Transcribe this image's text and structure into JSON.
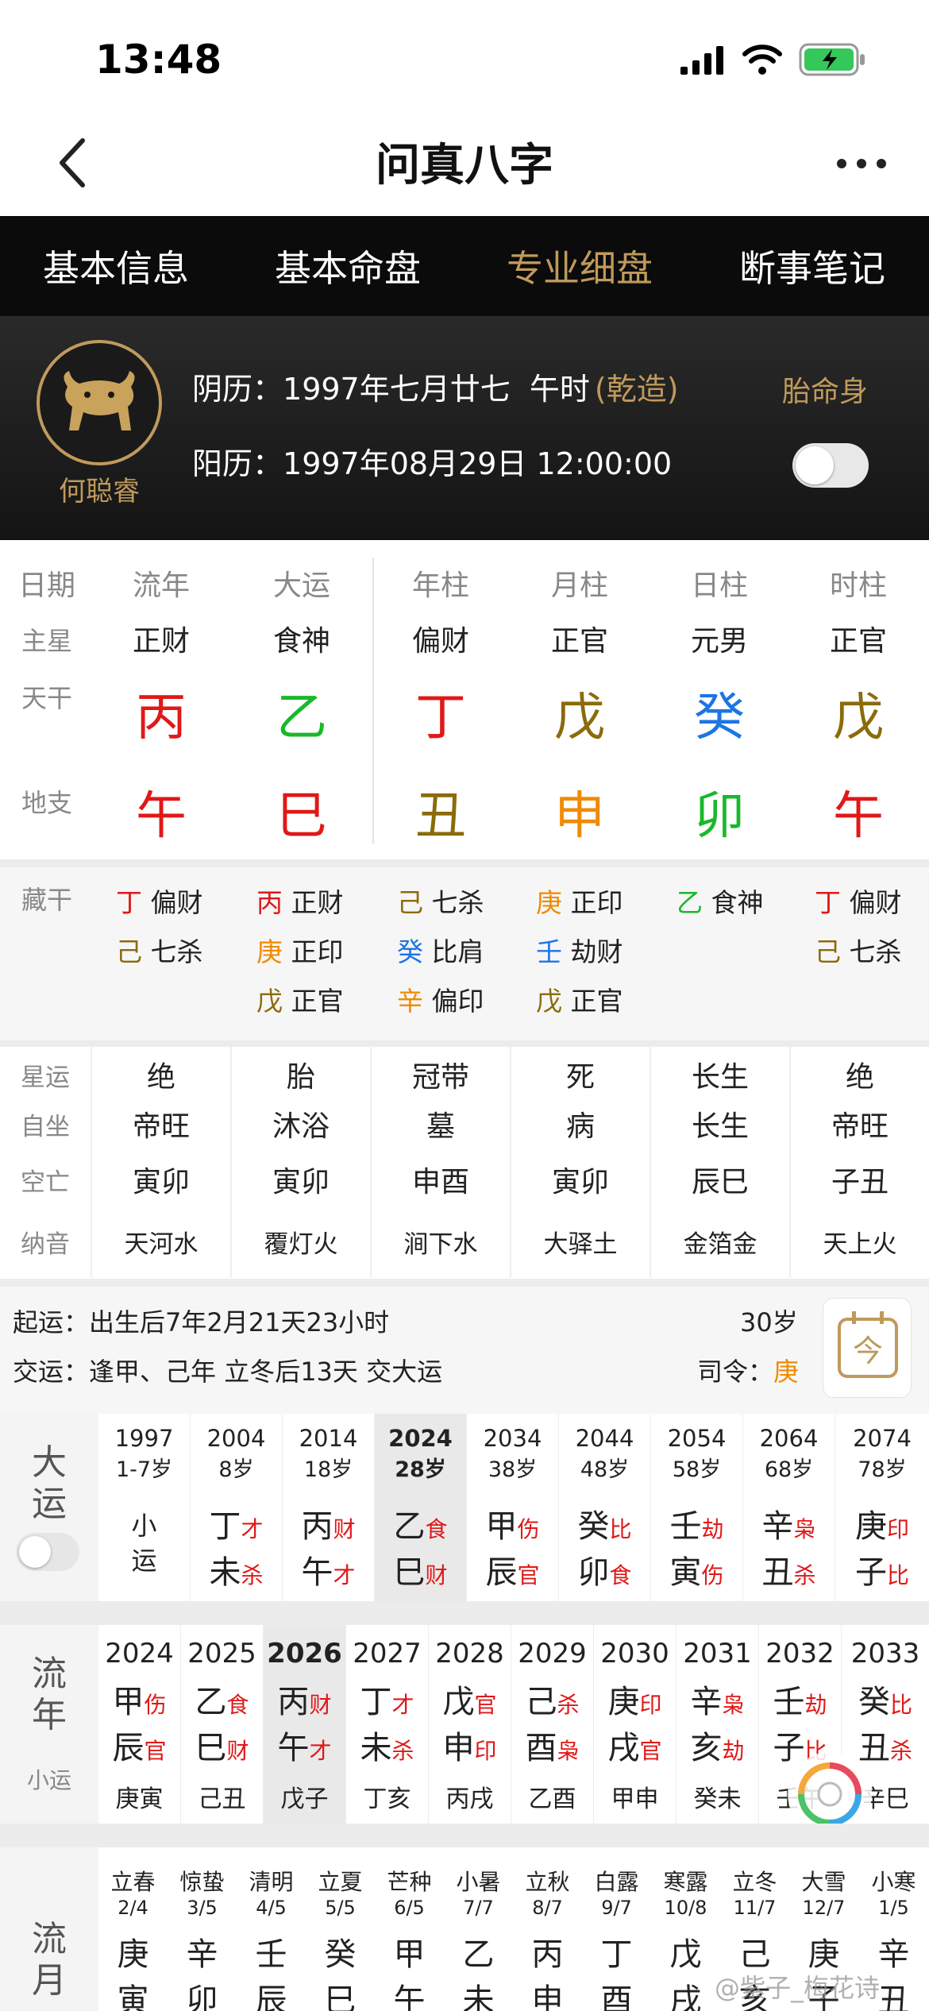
{
  "status": {
    "time": "13:48"
  },
  "nav": {
    "title": "问真八字"
  },
  "tabs": [
    "基本信息",
    "基本命盘",
    "专业细盘",
    "断事笔记"
  ],
  "profile": {
    "name": "何聪睿",
    "lunar_label": "阴历：",
    "lunar_value": "1997年七月廿七  午时",
    "gender_tag": "(乾造)",
    "solar_label": "阳历：",
    "solar_value": "1997年08月29日 12:00:00",
    "taiming_label": "胎命身"
  },
  "colors": {
    "red": "#e01818",
    "green": "#19b82a",
    "olive": "#8b6b0a",
    "blue": "#1d74e6",
    "orange": "#f08a00",
    "gold": "#c09a5b"
  },
  "pillars": {
    "header": [
      "日期",
      "流年",
      "大运",
      "年柱",
      "月柱",
      "日柱",
      "时柱"
    ],
    "row_labels": [
      "主星",
      "天干",
      "地支"
    ],
    "zhuxing": [
      "正财",
      "食神",
      "偏财",
      "正官",
      "元男",
      "正官"
    ],
    "tiangan": [
      {
        "c": "丙",
        "color": "red"
      },
      {
        "c": "乙",
        "color": "green"
      },
      {
        "c": "丁",
        "color": "red"
      },
      {
        "c": "戊",
        "color": "olive"
      },
      {
        "c": "癸",
        "color": "blue"
      },
      {
        "c": "戊",
        "color": "olive"
      }
    ],
    "dizhi": [
      {
        "c": "午",
        "color": "red"
      },
      {
        "c": "巳",
        "color": "red"
      },
      {
        "c": "丑",
        "color": "olive"
      },
      {
        "c": "申",
        "color": "orange"
      },
      {
        "c": "卯",
        "color": "green"
      },
      {
        "c": "午",
        "color": "red"
      }
    ]
  },
  "canggan": {
    "label": "藏干",
    "columns": [
      [
        {
          "g": "丁",
          "color": "red",
          "s": "偏财"
        },
        {
          "g": "己",
          "color": "olive",
          "s": "七杀"
        }
      ],
      [
        {
          "g": "丙",
          "color": "red",
          "s": "正财"
        },
        {
          "g": "庚",
          "color": "orange",
          "s": "正印"
        },
        {
          "g": "戊",
          "color": "olive",
          "s": "正官"
        }
      ],
      [
        {
          "g": "己",
          "color": "olive",
          "s": "七杀"
        },
        {
          "g": "癸",
          "color": "blue",
          "s": "比肩"
        },
        {
          "g": "辛",
          "color": "orange",
          "s": "偏印"
        }
      ],
      [
        {
          "g": "庚",
          "color": "orange",
          "s": "正印"
        },
        {
          "g": "壬",
          "color": "blue",
          "s": "劫财"
        },
        {
          "g": "戊",
          "color": "olive",
          "s": "正官"
        }
      ],
      [
        {
          "g": "乙",
          "color": "green",
          "s": "食神"
        }
      ],
      [
        {
          "g": "丁",
          "color": "red",
          "s": "偏财"
        },
        {
          "g": "己",
          "color": "olive",
          "s": "七杀"
        }
      ]
    ]
  },
  "xingyun": {
    "labels": [
      "星运",
      "自坐",
      "空亡",
      "纳音"
    ],
    "columns": [
      [
        "绝",
        "帝旺",
        "寅卯",
        "天河水"
      ],
      [
        "胎",
        "沐浴",
        "寅卯",
        "覆灯火"
      ],
      [
        "冠带",
        "墓",
        "申酉",
        "涧下水"
      ],
      [
        "死",
        "病",
        "寅卯",
        "大驿土"
      ],
      [
        "长生",
        "长生",
        "辰巳",
        "金箔金"
      ],
      [
        "绝",
        "帝旺",
        "子丑",
        "天上火"
      ]
    ]
  },
  "qiyun": {
    "qiyun_label": "起运：",
    "qiyun_text": "出生后7年2月21天23小时",
    "age": "30岁",
    "jiaoyun_label": "交运：",
    "jiaoyun_text": "逢甲、己年 立冬后13天 交大运",
    "siling_label": "司令：",
    "siling_value": "庚",
    "today_icon": "今"
  },
  "dayun": {
    "label": "大运",
    "items": [
      {
        "year": "1997",
        "age": "1-7岁",
        "small": "小\n运"
      },
      {
        "year": "2004",
        "age": "8岁",
        "g": "丁",
        "gs": "才",
        "z": "未",
        "zs": "杀"
      },
      {
        "year": "2014",
        "age": "18岁",
        "g": "丙",
        "gs": "财",
        "z": "午",
        "zs": "才"
      },
      {
        "year": "2024",
        "age": "28岁",
        "g": "乙",
        "gs": "食",
        "z": "巳",
        "zs": "财",
        "selected": true
      },
      {
        "year": "2034",
        "age": "38岁",
        "g": "甲",
        "gs": "伤",
        "z": "辰",
        "zs": "官"
      },
      {
        "year": "2044",
        "age": "48岁",
        "g": "癸",
        "gs": "比",
        "z": "卯",
        "zs": "食"
      },
      {
        "year": "2054",
        "age": "58岁",
        "g": "壬",
        "gs": "劫",
        "z": "寅",
        "zs": "伤"
      },
      {
        "year": "2064",
        "age": "68岁",
        "g": "辛",
        "gs": "枭",
        "z": "丑",
        "zs": "杀"
      },
      {
        "year": "2074",
        "age": "78岁",
        "g": "庚",
        "gs": "印",
        "z": "子",
        "zs": "比"
      }
    ]
  },
  "liunian": {
    "label": "流年",
    "sub_label": "小运",
    "items": [
      {
        "year": "2024",
        "g": "甲",
        "gs": "伤",
        "z": "辰",
        "zs": "官",
        "xy": "庚寅"
      },
      {
        "year": "2025",
        "g": "乙",
        "gs": "食",
        "z": "巳",
        "zs": "财",
        "xy": "己丑"
      },
      {
        "year": "2026",
        "g": "丙",
        "gs": "财",
        "z": "午",
        "zs": "才",
        "xy": "戊子",
        "selected": true
      },
      {
        "year": "2027",
        "g": "丁",
        "gs": "才",
        "z": "未",
        "zs": "杀",
        "xy": "丁亥"
      },
      {
        "year": "2028",
        "g": "戊",
        "gs": "官",
        "z": "申",
        "zs": "印",
        "xy": "丙戌"
      },
      {
        "year": "2029",
        "g": "己",
        "gs": "杀",
        "z": "酉",
        "zs": "枭",
        "xy": "乙酉"
      },
      {
        "year": "2030",
        "g": "庚",
        "gs": "印",
        "z": "戌",
        "zs": "官",
        "xy": "甲申"
      },
      {
        "year": "2031",
        "g": "辛",
        "gs": "枭",
        "z": "亥",
        "zs": "劫",
        "xy": "癸未"
      },
      {
        "year": "2032",
        "g": "壬",
        "gs": "劫",
        "z": "子",
        "zs": "比",
        "xy": "壬午"
      },
      {
        "year": "2033",
        "g": "癸",
        "gs": "比",
        "z": "丑",
        "zs": "杀",
        "xy": "辛巳"
      }
    ]
  },
  "liuyue": {
    "label": "流月",
    "items": [
      {
        "jq": "立春",
        "d": "2/4",
        "g": "庚",
        "z": "寅"
      },
      {
        "jq": "惊蛰",
        "d": "3/5",
        "g": "辛",
        "z": "卯"
      },
      {
        "jq": "清明",
        "d": "4/5",
        "g": "壬",
        "z": "辰"
      },
      {
        "jq": "立夏",
        "d": "5/5",
        "g": "癸",
        "z": "巳"
      },
      {
        "jq": "芒种",
        "d": "6/5",
        "g": "甲",
        "z": "午"
      },
      {
        "jq": "小暑",
        "d": "7/7",
        "g": "乙",
        "z": "未"
      },
      {
        "jq": "立秋",
        "d": "8/7",
        "g": "丙",
        "z": "申"
      },
      {
        "jq": "白露",
        "d": "9/7",
        "g": "丁",
        "z": "酉"
      },
      {
        "jq": "寒露",
        "d": "10/8",
        "g": "戊",
        "z": "戌"
      },
      {
        "jq": "立冬",
        "d": "11/7",
        "g": "己",
        "z": "亥"
      },
      {
        "jq": "大雪",
        "d": "12/7",
        "g": "庚",
        "z": "子"
      },
      {
        "jq": "小寒",
        "d": "1/5",
        "g": "辛",
        "z": "丑"
      }
    ]
  },
  "watermark": "@紫子_梅花诗"
}
